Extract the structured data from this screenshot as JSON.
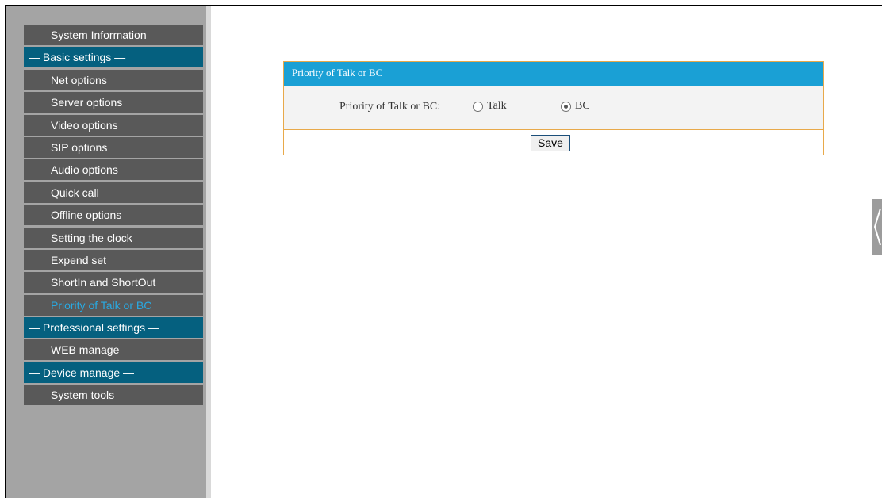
{
  "sidebar": {
    "items": [
      {
        "label": "System Information",
        "kind": "item"
      },
      {
        "label": "— Basic settings —",
        "kind": "group"
      },
      {
        "label": "Net options",
        "kind": "item"
      },
      {
        "label": "Server options",
        "kind": "item"
      },
      {
        "label": "Video options",
        "kind": "item"
      },
      {
        "label": "SIP options",
        "kind": "item"
      },
      {
        "label": "Audio options",
        "kind": "item"
      },
      {
        "label": "Quick call",
        "kind": "item"
      },
      {
        "label": "Offline options",
        "kind": "item"
      },
      {
        "label": "Setting the clock",
        "kind": "item"
      },
      {
        "label": "Expend set",
        "kind": "item"
      },
      {
        "label": "ShortIn and ShortOut",
        "kind": "item"
      },
      {
        "label": "Priority of Talk or BC",
        "kind": "item",
        "active": true
      },
      {
        "label": "— Professional settings —",
        "kind": "group"
      },
      {
        "label": "WEB manage",
        "kind": "item"
      },
      {
        "label": "— Device manage —",
        "kind": "group"
      },
      {
        "label": "System tools",
        "kind": "item"
      }
    ]
  },
  "panel": {
    "title": "Priority of Talk or BC",
    "field_label": "Priority of Talk or BC:",
    "options": [
      {
        "label": "Talk",
        "checked": false
      },
      {
        "label": "BC",
        "checked": true
      }
    ],
    "save_label": "Save"
  },
  "colors": {
    "sidebar_bg": "#a4a4a4",
    "menu_item_bg": "#595959",
    "group_bg": "#05607f",
    "active_text": "#29a9e1",
    "panel_header": "#1aa0d5",
    "panel_border": "#e8a94a"
  },
  "icons": {
    "side_tab": "chevron-left-icon"
  }
}
